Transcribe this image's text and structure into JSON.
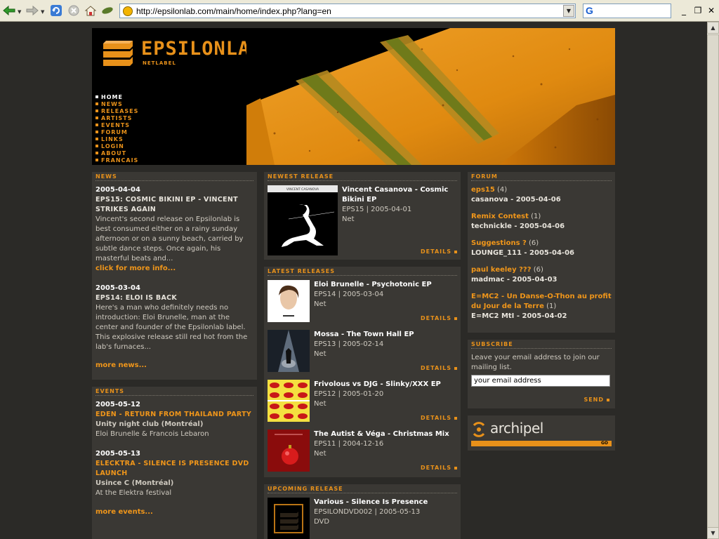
{
  "browser": {
    "url": "http://epsilonlab.com/main/home/index.php?lang=en",
    "search_logo": "G"
  },
  "site": {
    "logo_text": "EPSILONLAB",
    "logo_sub": "NETLABEL",
    "nav": [
      {
        "label": "HOME",
        "active": true
      },
      {
        "label": "NEWS"
      },
      {
        "label": "RELEASES"
      },
      {
        "label": "ARTISTS"
      },
      {
        "label": "EVENTS"
      },
      {
        "label": "FORUM"
      },
      {
        "label": "LINKS"
      },
      {
        "label": "LOGIN"
      },
      {
        "label": "ABOUT"
      },
      {
        "label": "FRANCAIS"
      }
    ]
  },
  "news": {
    "title": "NEWS",
    "items": [
      {
        "date": "2005-04-04",
        "headline": "EPS15: COSMIC BIKINI EP - VINCENT STRIKES AGAIN",
        "body": "Vincent's second release on Epsilonlab is best consumed either on a rainy sunday afternoon or on a sunny beach, carried by subtle dance steps. Once again, his masterful beats and...",
        "link": "click for more info..."
      },
      {
        "date": "2005-03-04",
        "headline": "EPS14: ELOI IS BACK",
        "body": "Here's a man who definitely needs no introduction: Eloi Brunelle, man at the center and founder of the Epsilonlab label. This explosive release still red hot from the lab's furnaces...",
        "link": ""
      }
    ],
    "more": "more news..."
  },
  "events": {
    "title": "EVENTS",
    "items": [
      {
        "date": "2005-05-12",
        "title": "EDEN - RETURN FROM THAILAND PARTY",
        "venue": "Unity night club (Montréal)",
        "desc": "Eloi Brunelle & Francois Lebaron"
      },
      {
        "date": "2005-05-13",
        "title": "ELECKTRA - SILENCE IS PRESENCE DVD LAUNCH",
        "venue": "Usince C (Montréal)",
        "desc": "At the Elektra festival"
      }
    ],
    "more": "more events..."
  },
  "newest": {
    "title": "NEWEST RELEASE",
    "release": {
      "title": "Vincent Casanova - Cosmic Bikini EP",
      "meta": "EPS15 | 2005-04-01",
      "net": "Net",
      "cover_text": "VINCENT CASANOVA"
    },
    "details": "DETAILS"
  },
  "latest": {
    "title": "LATEST RELEASES",
    "releases": [
      {
        "title": "Eloi Brunelle - Psychotonic EP",
        "meta": "EPS14 | 2005-03-04",
        "net": "Net"
      },
      {
        "title": "Mossa - The Town Hall EP",
        "meta": "EPS13 | 2005-02-14",
        "net": "Net"
      },
      {
        "title": "Frivolous vs DJG - Slinky/XXX EP",
        "meta": "EPS12 | 2005-01-20",
        "net": "Net"
      },
      {
        "title": "The Autist & Véga - Christmas Mix",
        "meta": "EPS11 | 2004-12-16",
        "net": "Net"
      }
    ],
    "details": "DETAILS"
  },
  "upcoming": {
    "title": "UPCOMING RELEASE",
    "release": {
      "title": "Various - Silence Is Presence",
      "meta": "EPSILONDVD002 | 2005-05-13",
      "net": "DVD"
    }
  },
  "forum": {
    "title": "FORUM",
    "items": [
      {
        "topic": "eps15",
        "count": "(4)",
        "meta": "casanova - 2005-04-06"
      },
      {
        "topic": "Remix Contest",
        "count": "(1)",
        "meta": "technickle - 2005-04-06"
      },
      {
        "topic": "Suggestions ?",
        "count": "(6)",
        "meta": "LOUNGE_111 - 2005-04-06"
      },
      {
        "topic": "paul keeley ???",
        "count": "(6)",
        "meta": "madmac - 2005-04-03"
      },
      {
        "topic": "E=MC2 - Un Danse-O-Thon au profit du Jour de la Terre",
        "count": "(1)",
        "meta": "E=MC2 MtI - 2005-04-02"
      }
    ]
  },
  "subscribe": {
    "title": "SUBSCRIBE",
    "text": "Leave your email address to join our mailing list.",
    "placeholder": "your email address",
    "send": "SEND"
  },
  "archipel": {
    "logo_text": "archipel",
    "go": "GO"
  },
  "colors": {
    "accent": "#e8911a",
    "panel": "#3a3834",
    "bg": "#2b2a27"
  }
}
